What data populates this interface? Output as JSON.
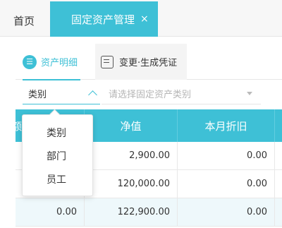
{
  "top_tabs": {
    "home_label": "首页",
    "active_label": "固定资产管理",
    "close_glyph": "×"
  },
  "sub_tabs": {
    "detail": {
      "icon": "list-circle-icon",
      "label": "资产明细"
    },
    "change": {
      "icon": "document-icon",
      "label": "变更·生成凭证"
    }
  },
  "filter": {
    "category_value": "类别",
    "asset_placeholder": "请选择固定资产类别"
  },
  "dropdown": {
    "options": [
      "类别",
      "部门",
      "员工"
    ]
  },
  "table": {
    "columns": [
      "额",
      "净值",
      "本月折旧"
    ],
    "rows": [
      [
        "",
        "2,900.00",
        "0.00"
      ],
      [
        "",
        "120,000.00",
        "0.00"
      ],
      [
        "0.00",
        "122,900.00",
        "0.00"
      ]
    ]
  },
  "colors": {
    "accent": "#3ec0d6",
    "row_alt": "#eef8fb"
  }
}
